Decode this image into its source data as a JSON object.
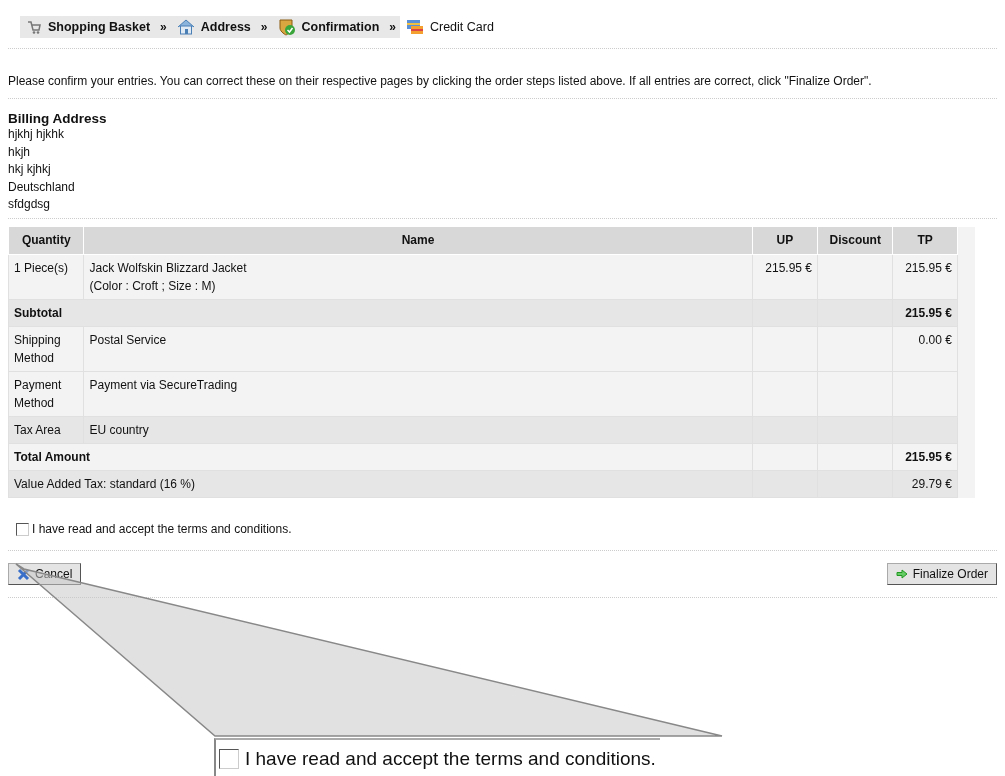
{
  "breadcrumb": [
    {
      "label": "Shopping Basket",
      "kind": "cart",
      "visited": true
    },
    {
      "label": "Address",
      "kind": "house",
      "visited": true
    },
    {
      "label": "Confirmation",
      "kind": "shield",
      "visited": true
    },
    {
      "label": "Credit Card",
      "kind": "card",
      "visited": false
    }
  ],
  "separator": "»",
  "intro": "Please confirm your entries. You can correct these on their respective pages by clicking the order steps listed above. If all entries are correct, click \"Finalize Order\".",
  "billing": {
    "heading": "Billing Address",
    "lines": [
      "hjkhj hjkhk",
      "hkjh",
      "hkj kjhkj",
      "Deutschland",
      "sfdgdsg"
    ]
  },
  "table": {
    "columns": [
      "Quantity",
      "Name",
      "UP",
      "Discount",
      "TP"
    ],
    "rows": [
      {
        "kind": "item",
        "shaded": false,
        "quantity": "1 Piece(s)",
        "name": [
          "Jack Wolfskin Blizzard Jacket",
          "(Color : Croft ; Size : M)"
        ],
        "up": "215.95 €",
        "tp": "215.95 €"
      },
      {
        "kind": "sum",
        "shaded": true,
        "label": "Subtotal",
        "tp": "215.95 €"
      },
      {
        "kind": "item",
        "shaded": false,
        "quantity": "Shipping Method",
        "name": [
          "Postal Service"
        ],
        "tp": "0.00 €"
      },
      {
        "kind": "item",
        "shaded": false,
        "quantity": "Payment Method",
        "name": [
          "Payment via SecureTrading"
        ]
      },
      {
        "kind": "item",
        "shaded": true,
        "quantity": "Tax Area",
        "name": [
          "EU country"
        ]
      },
      {
        "kind": "sum",
        "shaded": false,
        "label": "Total Amount",
        "tp": "215.95 €"
      },
      {
        "kind": "note",
        "shaded": true,
        "label": "Value Added Tax: standard (16 %)",
        "tp": "29.79 €"
      }
    ]
  },
  "terms": {
    "label": "I have read and accept the terms and conditions.",
    "checked": false
  },
  "buttons": [
    {
      "label": "Cancel",
      "kind": "cancel"
    },
    {
      "label": "Finalize Order",
      "kind": "submit"
    }
  ],
  "callout": {
    "label": "I have read and accept the terms and conditions.",
    "checked": false
  }
}
